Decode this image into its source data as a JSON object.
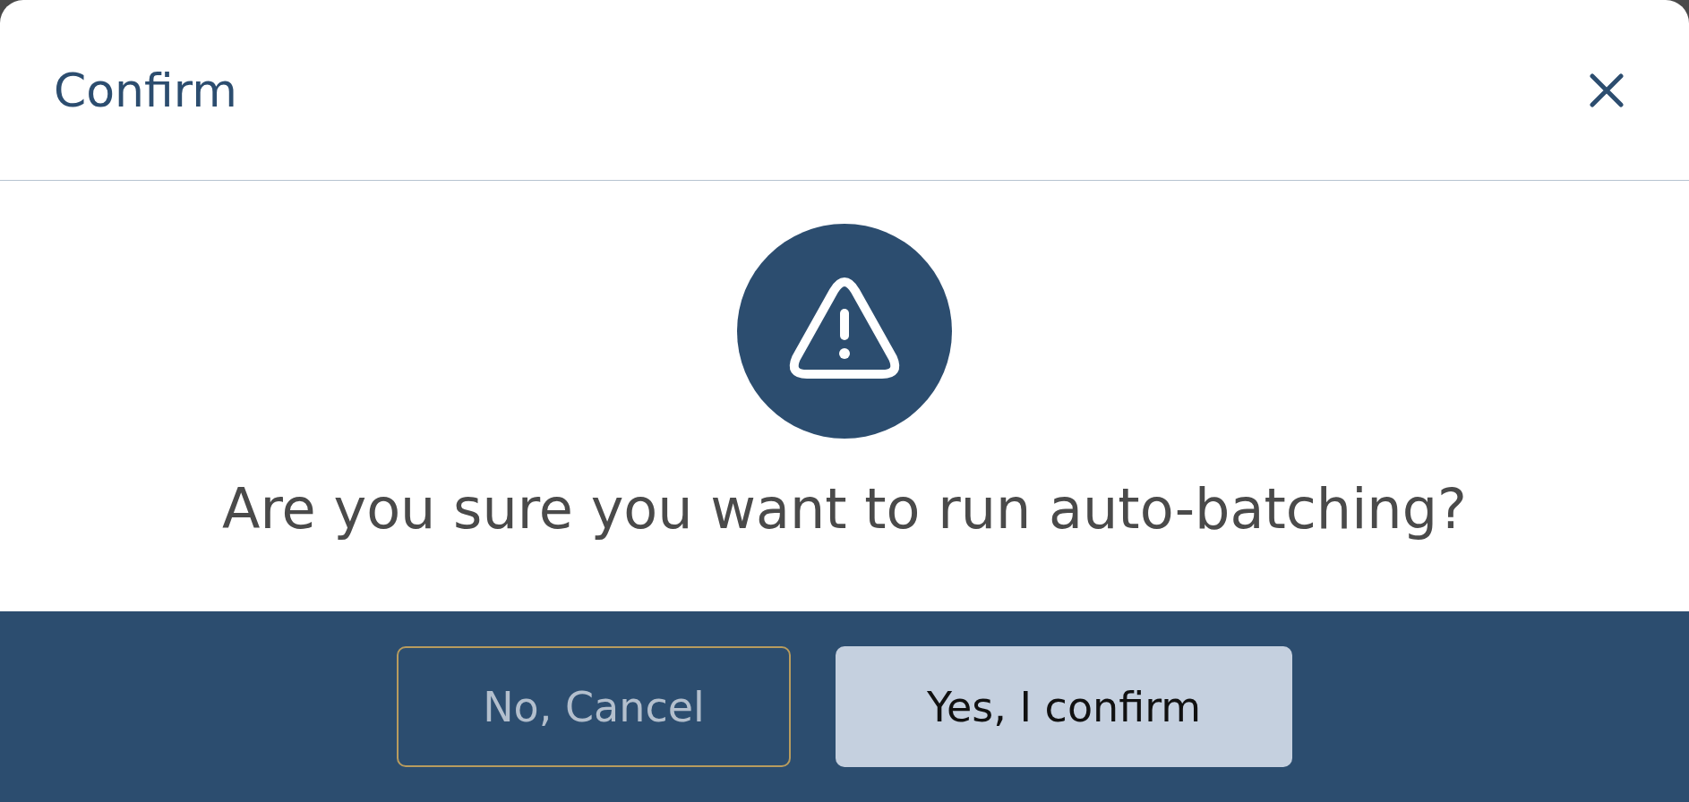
{
  "dialog": {
    "title": "Confirm",
    "message": "Are you sure you want to run auto-batching?",
    "buttons": [
      {
        "label": "No, Cancel",
        "kind": "secondary"
      },
      {
        "label": "Yes, I confirm",
        "kind": "primary"
      }
    ]
  }
}
